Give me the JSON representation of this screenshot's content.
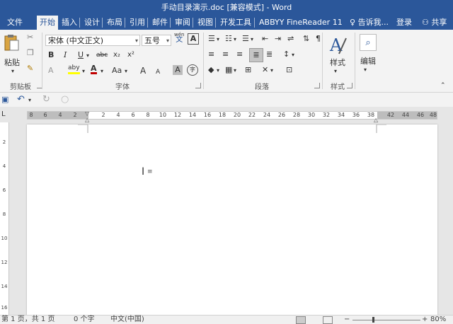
{
  "window": {
    "title": "手动目录演示.doc [兼容模式] - Word"
  },
  "tabs": [
    {
      "label": "文件"
    },
    {
      "label": "开始"
    },
    {
      "label": "插入"
    },
    {
      "label": "设计"
    },
    {
      "label": "布局"
    },
    {
      "label": "引用"
    },
    {
      "label": "邮件"
    },
    {
      "label": "审阅"
    },
    {
      "label": "视图"
    },
    {
      "label": "开发工具"
    },
    {
      "label": "ABBYY FineReader 11"
    }
  ],
  "tell_me": "告诉我...",
  "login": "登录",
  "share": "共享",
  "ribbon": {
    "clipboard": {
      "paste_label": "粘贴",
      "group_label": "剪贴板"
    },
    "font": {
      "font_name": "宋体 (中文正文)",
      "font_size": "五号",
      "wen_top": "wén",
      "wen_bottom": "文",
      "boxed_a": "A",
      "bold": "B",
      "italic": "I",
      "underline": "U",
      "strike": "abc",
      "subscript": "x₂",
      "superscript": "x²",
      "clear": "A",
      "highlight": "aby",
      "font_color": "A",
      "change_case": "Aa",
      "grow": "A",
      "shrink": "A",
      "shade": "A",
      "phonetic": "字",
      "group_label": "字体"
    },
    "paragraph": {
      "group_label": "段落"
    },
    "styles": {
      "label": "样式",
      "group_label": "样式"
    },
    "editing": {
      "label": "编辑"
    }
  },
  "ruler": {
    "left_ticks": [
      "8",
      "6",
      "4",
      "2"
    ],
    "right_ticks": [
      "2",
      "4",
      "6",
      "8",
      "10",
      "12",
      "14",
      "16",
      "18",
      "20",
      "22",
      "24",
      "26",
      "28",
      "30",
      "32",
      "34",
      "36",
      "38"
    ],
    "margin_ticks": [
      "42",
      "44",
      "46",
      "48"
    ],
    "vertical_ticks": [
      "2",
      "4",
      "6",
      "8",
      "10",
      "12",
      "14",
      "16"
    ]
  },
  "status": {
    "page": "第 1 页，共 1 页",
    "words": "0 个字",
    "language": "中文(中国)",
    "zoom": "80%"
  },
  "colors": {
    "accent": "#2b579a",
    "highlight": "#ffff00",
    "font_color": "#c00000"
  }
}
